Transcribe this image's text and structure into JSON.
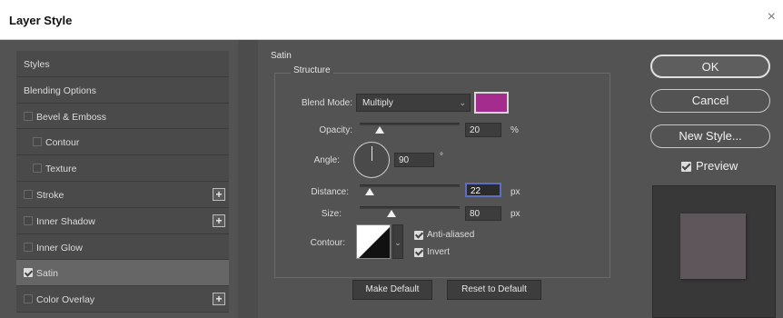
{
  "window": {
    "title": "Layer Style",
    "close_glyph": "×"
  },
  "style_list": [
    {
      "label": "Styles",
      "checkbox": false,
      "checked": false,
      "plus": false,
      "selected": false,
      "indent": 0
    },
    {
      "label": "Blending Options",
      "checkbox": false,
      "checked": false,
      "plus": false,
      "selected": false,
      "indent": 0
    },
    {
      "label": "Bevel & Emboss",
      "checkbox": true,
      "checked": false,
      "plus": false,
      "selected": false,
      "indent": 0
    },
    {
      "label": "Contour",
      "checkbox": true,
      "checked": false,
      "plus": false,
      "selected": false,
      "indent": 1
    },
    {
      "label": "Texture",
      "checkbox": true,
      "checked": false,
      "plus": false,
      "selected": false,
      "indent": 1
    },
    {
      "label": "Stroke",
      "checkbox": true,
      "checked": false,
      "plus": true,
      "selected": false,
      "indent": 0
    },
    {
      "label": "Inner Shadow",
      "checkbox": true,
      "checked": false,
      "plus": true,
      "selected": false,
      "indent": 0
    },
    {
      "label": "Inner Glow",
      "checkbox": true,
      "checked": false,
      "plus": false,
      "selected": false,
      "indent": 0
    },
    {
      "label": "Satin",
      "checkbox": true,
      "checked": true,
      "plus": false,
      "selected": true,
      "indent": 0
    },
    {
      "label": "Color Overlay",
      "checkbox": true,
      "checked": false,
      "plus": true,
      "selected": false,
      "indent": 0
    }
  ],
  "plus_glyph": "+",
  "satin": {
    "group_title": "Satin",
    "structure_title": "Structure",
    "blend_mode": {
      "label": "Blend Mode:",
      "value": "Multiply",
      "caret": "⌄"
    },
    "color": "#a42c8e",
    "opacity": {
      "label": "Opacity:",
      "value": "20",
      "unit": "%",
      "fraction": 0.2
    },
    "angle": {
      "label": "Angle:",
      "value": "90",
      "unit": "°"
    },
    "distance": {
      "label": "Distance:",
      "value": "22",
      "unit": "px",
      "fraction": 0.1
    },
    "size": {
      "label": "Size:",
      "value": "80",
      "unit": "px",
      "fraction": 0.32
    },
    "contour": {
      "label": "Contour:",
      "caret": "⌄"
    },
    "anti_aliased": {
      "label": "Anti-aliased",
      "checked": true
    },
    "invert": {
      "label": "Invert",
      "checked": true
    },
    "make_default": "Make Default",
    "reset_default": "Reset to Default"
  },
  "right_panel": {
    "ok": "OK",
    "cancel": "Cancel",
    "new_style": "New Style...",
    "preview": {
      "label": "Preview",
      "checked": true
    },
    "preview_color": "#5f565b"
  }
}
